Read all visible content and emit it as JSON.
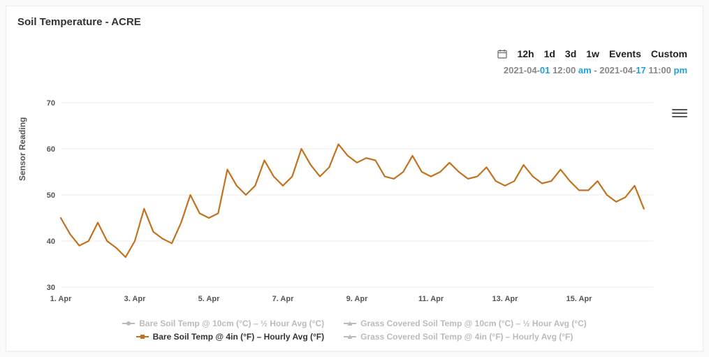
{
  "title": "Soil Temperature - ACRE",
  "range_buttons": [
    "12h",
    "1d",
    "3d",
    "1w",
    "Events",
    "Custom"
  ],
  "date_range": {
    "from_prefix": "2021-04-",
    "from_day": "01",
    "from_time": " 12:",
    "from_minute": "00 ",
    "from_ampm": "am",
    "separator": "  -  ",
    "to_prefix": "2021-04-",
    "to_day": "17",
    "to_time": " 11:",
    "to_minute": "00 ",
    "to_ampm": "pm"
  },
  "legend": [
    {
      "label": "Bare Soil Temp @ 10cm (°C) – ½ Hour Avg (°C)",
      "active": false,
      "color": "#bbbbbb",
      "shape": "circle"
    },
    {
      "label": "Grass Covered Soil Temp @ 10cm (°C) – ½ Hour Avg (°C)",
      "active": false,
      "color": "#bbbbbb",
      "shape": "triangle"
    },
    {
      "label": "Bare Soil Temp @ 4in (°F) – Hourly Avg (°F)",
      "active": true,
      "color": "#c2721e",
      "shape": "square"
    },
    {
      "label": "Grass Covered Soil Temp @ 4in (°F) – Hourly Avg (°F)",
      "active": false,
      "color": "#bbbbbb",
      "shape": "triangle"
    }
  ],
  "chart_data": {
    "type": "line",
    "title": "Soil Temperature - ACRE",
    "xlabel": "",
    "ylabel": "Sensor Reading",
    "ylim": [
      30,
      70
    ],
    "y_ticks": [
      30,
      40,
      50,
      60,
      70
    ],
    "x_domain_days": [
      1,
      17
    ],
    "x_ticks": [
      {
        "value": 1,
        "label": "1. Apr"
      },
      {
        "value": 3,
        "label": "3. Apr"
      },
      {
        "value": 5,
        "label": "5. Apr"
      },
      {
        "value": 7,
        "label": "7. Apr"
      },
      {
        "value": 9,
        "label": "9. Apr"
      },
      {
        "value": 11,
        "label": "11. Apr"
      },
      {
        "value": 13,
        "label": "13. Apr"
      },
      {
        "value": 15,
        "label": "15. Apr"
      }
    ],
    "series": [
      {
        "name": "Bare Soil Temp @ 4in (°F) – Hourly Avg (°F)",
        "color": "#c2721e",
        "x": [
          1.0,
          1.25,
          1.5,
          1.75,
          2.0,
          2.25,
          2.5,
          2.75,
          3.0,
          3.25,
          3.5,
          3.75,
          4.0,
          4.25,
          4.5,
          4.75,
          5.0,
          5.25,
          5.5,
          5.75,
          6.0,
          6.25,
          6.5,
          6.75,
          7.0,
          7.25,
          7.5,
          7.75,
          8.0,
          8.25,
          8.5,
          8.75,
          9.0,
          9.25,
          9.5,
          9.75,
          10.0,
          10.25,
          10.5,
          10.75,
          11.0,
          11.25,
          11.5,
          11.75,
          12.0,
          12.25,
          12.5,
          12.75,
          13.0,
          13.25,
          13.5,
          13.75,
          14.0,
          14.25,
          14.5,
          14.75,
          15.0,
          15.25,
          15.5,
          15.75,
          16.0,
          16.25,
          16.5
        ],
        "y": [
          45,
          41.5,
          39,
          40,
          44,
          40,
          38.5,
          36.5,
          40,
          47,
          42,
          40.5,
          39.5,
          44,
          50,
          46,
          45,
          46,
          55.5,
          52,
          50,
          52,
          57.5,
          54,
          52,
          54,
          60,
          56.5,
          54,
          56,
          61,
          58.5,
          57,
          58,
          57.5,
          54,
          53.5,
          55,
          58.5,
          55,
          54,
          55,
          57,
          55,
          53.5,
          54,
          56,
          53,
          52,
          53,
          56.5,
          54,
          52.5,
          53,
          55.5,
          53,
          51,
          51,
          53,
          50,
          48.5,
          49.5,
          52
        ],
        "last_y": 47
      }
    ]
  }
}
